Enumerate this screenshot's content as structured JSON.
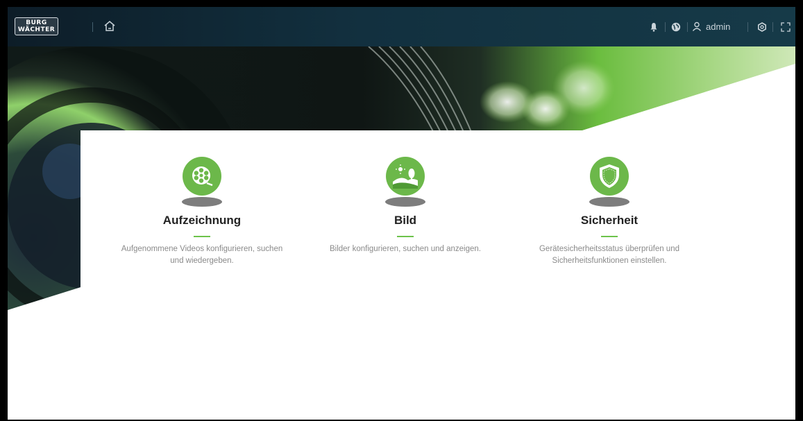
{
  "header": {
    "logo_line1": "BURG",
    "logo_line2": "WÄCHTER",
    "user": "admin"
  },
  "cards": [
    {
      "title": "Aufzeichnung",
      "description_line1": "Aufgenommene Videos konfigurieren, suchen",
      "description_line2": "und wiedergeben.",
      "icon": "film-reel-icon"
    },
    {
      "title": "Bild",
      "description_line1": "Bilder konfigurieren, suchen und anzeigen.",
      "description_line2": "",
      "icon": "landscape-image-icon"
    },
    {
      "title": "Sicherheit",
      "description_line1": "Gerätesicherheitsstatus überprüfen und",
      "description_line2": "Sicherheitsfunktionen einstellen.",
      "icon": "shield-icon"
    }
  ],
  "colors": {
    "accent": "#6cb84a",
    "topbar": "#12303f"
  }
}
